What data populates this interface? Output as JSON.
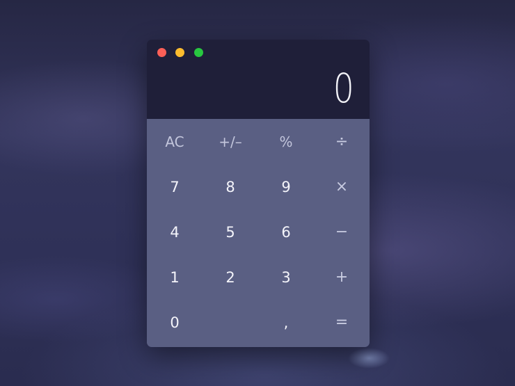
{
  "calculator": {
    "display_value": "0",
    "keys": [
      {
        "name": "all-clear-key",
        "label": "AC",
        "kind": "fn",
        "row": 0,
        "col": 0
      },
      {
        "name": "plus-minus-key",
        "label": "+/–",
        "kind": "fn",
        "row": 0,
        "col": 1
      },
      {
        "name": "percent-key",
        "label": "%",
        "kind": "fn",
        "row": 0,
        "col": 2
      },
      {
        "name": "divide-key",
        "label": "÷",
        "kind": "op",
        "row": 0,
        "col": 3
      },
      {
        "name": "digit-7-key",
        "label": "7",
        "kind": "num",
        "row": 1,
        "col": 0
      },
      {
        "name": "digit-8-key",
        "label": "8",
        "kind": "num",
        "row": 1,
        "col": 1
      },
      {
        "name": "digit-9-key",
        "label": "9",
        "kind": "num",
        "row": 1,
        "col": 2
      },
      {
        "name": "multiply-key",
        "label": "×",
        "kind": "op",
        "row": 1,
        "col": 3
      },
      {
        "name": "digit-4-key",
        "label": "4",
        "kind": "num",
        "row": 2,
        "col": 0
      },
      {
        "name": "digit-5-key",
        "label": "5",
        "kind": "num",
        "row": 2,
        "col": 1
      },
      {
        "name": "digit-6-key",
        "label": "6",
        "kind": "num",
        "row": 2,
        "col": 2
      },
      {
        "name": "subtract-key",
        "label": "−",
        "kind": "op",
        "row": 2,
        "col": 3
      },
      {
        "name": "digit-1-key",
        "label": "1",
        "kind": "num",
        "row": 3,
        "col": 0
      },
      {
        "name": "digit-2-key",
        "label": "2",
        "kind": "num",
        "row": 3,
        "col": 1
      },
      {
        "name": "digit-3-key",
        "label": "3",
        "kind": "num",
        "row": 3,
        "col": 2
      },
      {
        "name": "add-key",
        "label": "+",
        "kind": "op",
        "row": 3,
        "col": 3
      },
      {
        "name": "digit-0-key",
        "label": "0",
        "kind": "num",
        "row": 4,
        "col": 0
      },
      {
        "name": "decimal-key",
        "label": ",",
        "kind": "num",
        "row": 4,
        "col": 2
      },
      {
        "name": "equals-key",
        "label": "=",
        "kind": "op",
        "row": 4,
        "col": 3
      }
    ]
  },
  "window_controls": {
    "close_color": "#fc5f57",
    "minimize_color": "#fdbc2e",
    "zoom_color": "#28c840"
  },
  "colors": {
    "display_bg": "#1f1f39",
    "keypad_bg": "#5a5f83",
    "key_text": "#f4f4fa"
  }
}
